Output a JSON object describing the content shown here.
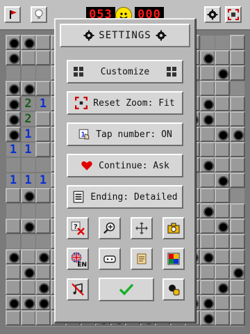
{
  "topbar": {
    "mines_counter": "053",
    "timer": "000",
    "buttons": [
      "flag-icon",
      "lightbulb-icon",
      "smiley-icon",
      "gear-icon",
      "reset-zoom-icon"
    ]
  },
  "board": {
    "numbers": [
      "2",
      "1",
      "2",
      "1",
      "1",
      "1",
      "1",
      "1",
      "1"
    ],
    "colors": {
      "one": "#0a2fd4",
      "two": "#1a5d1a"
    }
  },
  "settings": {
    "title": "SETTINGS",
    "customize": "Customize",
    "reset_zoom": "Reset Zoom: Fit",
    "tap_number": "Tap number: ON",
    "continue": "Continue: Ask",
    "ending": "Ending: Detailed",
    "language_code": "EN",
    "icon_grid": [
      "help-remove-icon",
      "zoom-in-icon",
      "move-icon",
      "camera-icon",
      "language-flag-icon",
      "gamepad-icon",
      "scroll-icon",
      "theme-icon",
      "music-off-icon",
      "ok-checkmark-icon",
      "mine-bag-icon"
    ]
  }
}
